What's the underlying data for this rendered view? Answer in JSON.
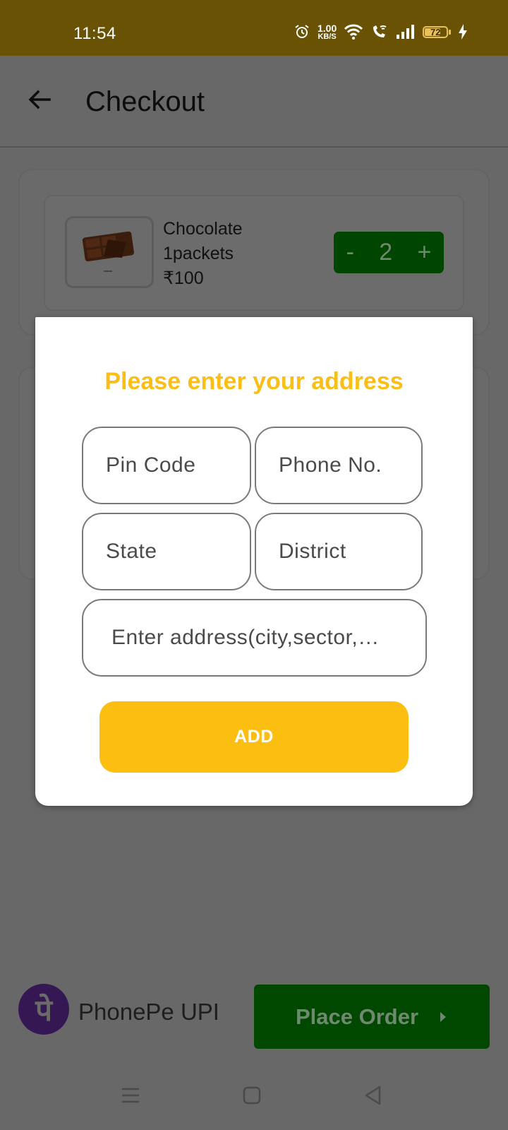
{
  "status_bar": {
    "time": "11:54",
    "net_speed_value": "1.00",
    "net_speed_unit": "KB/S",
    "battery": "72",
    "icons": [
      "alarm-icon",
      "wifi-icon",
      "wifi-calling-icon",
      "signal-icon",
      "battery-icon",
      "charging-icon"
    ]
  },
  "header": {
    "title": "Checkout",
    "back_icon": "arrow-left-icon"
  },
  "cart": {
    "items": [
      {
        "name": "Chocolate",
        "quantity_label": "1packets",
        "price": "₹100",
        "stepper": {
          "minus": "-",
          "count": "2",
          "plus": "+"
        }
      }
    ]
  },
  "dialog": {
    "title": "Please enter your address",
    "fields": {
      "pin_code": "Pin Code",
      "phone": "Phone No.",
      "state": "State",
      "district": "District",
      "address": "Enter address(city,sector,…"
    },
    "add_label": "ADD"
  },
  "payment": {
    "logo_glyph": "पे",
    "method": "PhonePe UPI",
    "place_order_label": "Place Order"
  },
  "colors": {
    "status_bar": "#6a5205",
    "accent_yellow": "#fbbe11",
    "order_green": "#004700",
    "phonepe_purple": "#351754",
    "scrim": "#686868"
  }
}
